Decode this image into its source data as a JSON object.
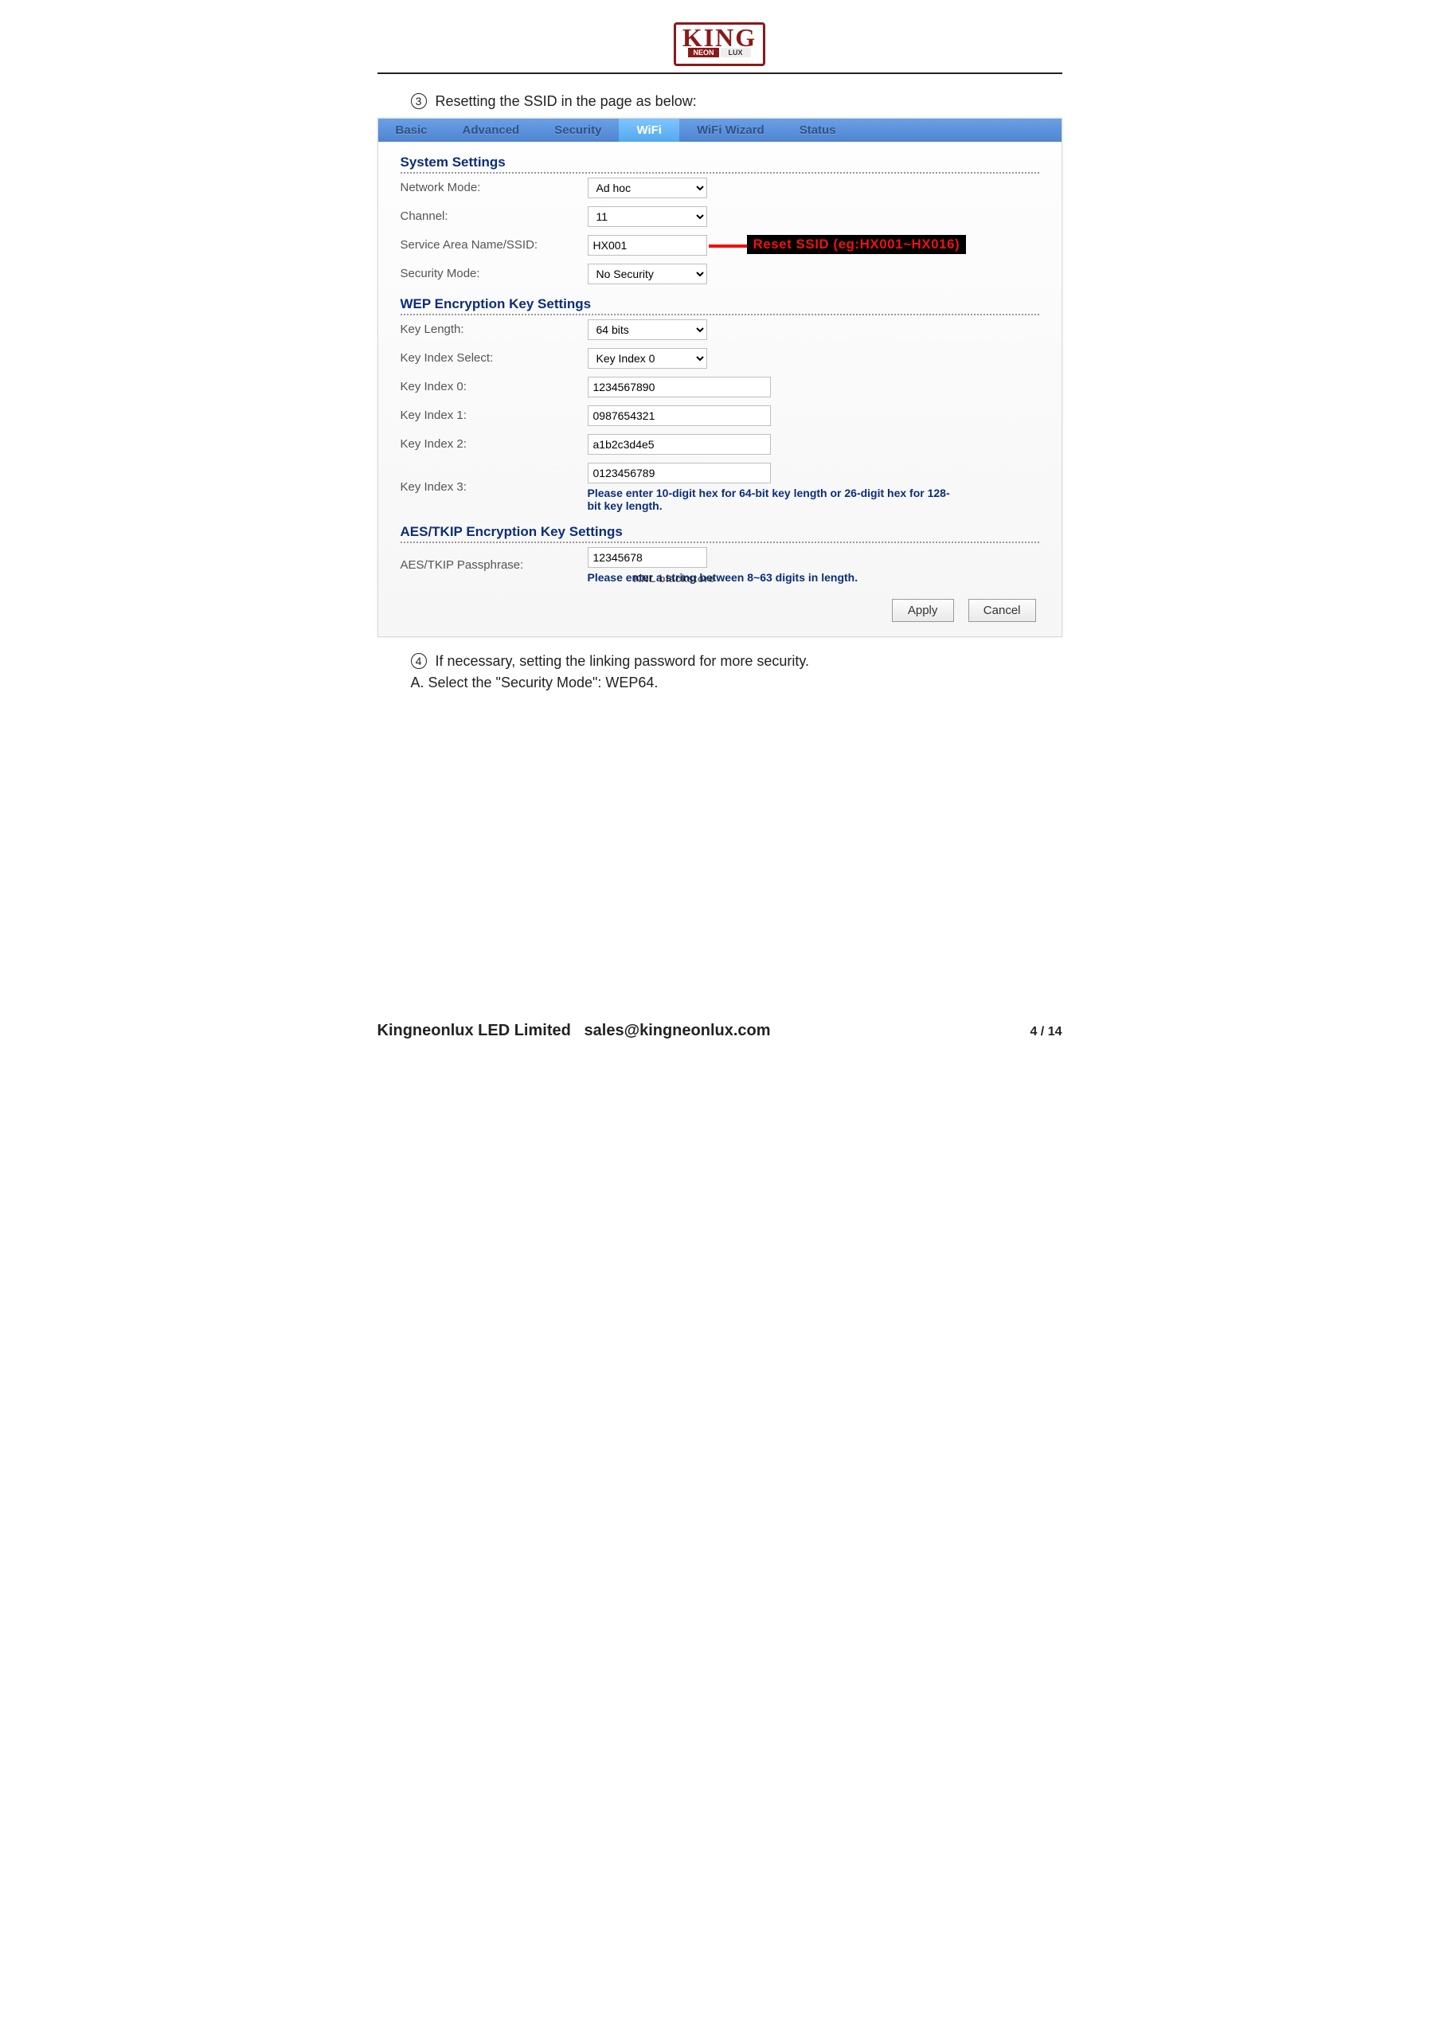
{
  "logo": {
    "top": "KING",
    "neon": "NEON",
    "lux": "LUX"
  },
  "step3": {
    "num": "3",
    "text": "Resetting the SSID in the page as below:"
  },
  "tabs": {
    "basic": "Basic",
    "advanced": "Advanced",
    "security": "Security",
    "wifi": "WiFi",
    "wizard": "WiFi Wizard",
    "status": "Status"
  },
  "sections": {
    "system": "System Settings",
    "wep": "WEP Encryption Key Settings",
    "aes": "AES/TKIP Encryption Key Settings"
  },
  "labels": {
    "network_mode": "Network Mode:",
    "channel": "Channel:",
    "ssid": "Service Area Name/SSID:",
    "security_mode": "Security Mode:",
    "key_length": "Key Length:",
    "key_index_select": "Key Index Select:",
    "key_index_0": "Key Index 0:",
    "key_index_1": "Key Index 1:",
    "key_index_2": "Key Index 2:",
    "key_index_3": "Key Index 3:",
    "aes_pass": "AES/TKIP Passphrase:"
  },
  "values": {
    "network_mode": "Ad hoc",
    "channel": "11",
    "ssid": "HX001",
    "security_mode": "No Security",
    "key_length": "64 bits",
    "key_index_select": "Key Index 0",
    "key_index_0": "1234567890",
    "key_index_1": "0987654321",
    "key_index_2": "a1b2c3d4e5",
    "key_index_3": "0123456789",
    "aes_pass": "12345678"
  },
  "annotation": "Reset  SSID (eg:HX001~HX016)",
  "hints": {
    "wep": "Please enter 10-digit hex for 64-bit key length or 26-digit hex for 128-bit key length.",
    "aes": "Please enter a string between 8~63 digits in length.",
    "watermark": "KNL blackstore"
  },
  "buttons": {
    "apply": "Apply",
    "cancel": "Cancel"
  },
  "step4": {
    "num": "4",
    "text": "If necessary, setting the linking password for more security."
  },
  "step4a": "A. Select the \"Security Mode\": WEP64.",
  "footer": {
    "company": "Kingneonlux LED Limited",
    "email": "sales@kingneonlux.com",
    "page_cur": "4",
    "page_sep": " / ",
    "page_total": "14"
  }
}
